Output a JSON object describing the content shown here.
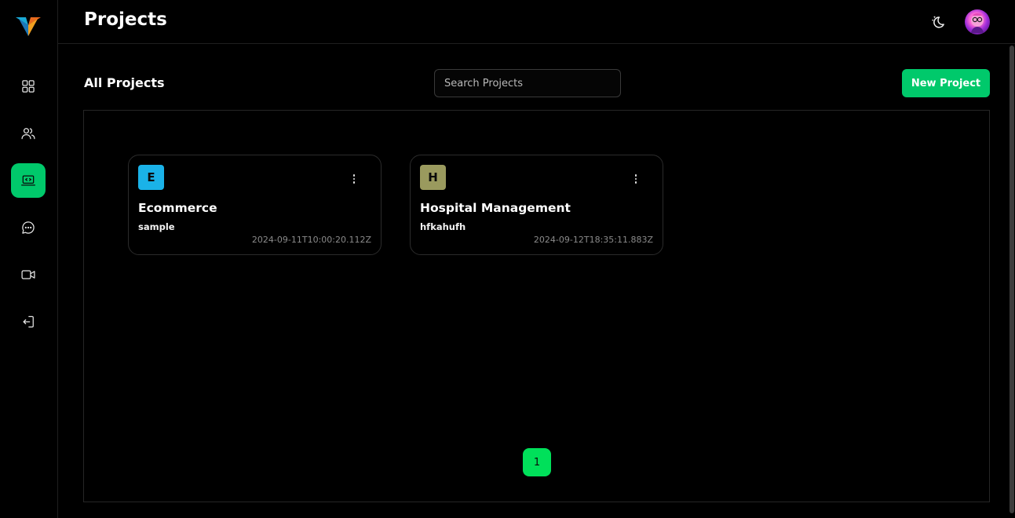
{
  "app": {
    "page_title": "Projects",
    "brand_colors": {
      "accent": "#00c96b",
      "page_accent": "#00e05a",
      "background": "#000000"
    }
  },
  "sidebar": {
    "items": [
      {
        "icon": "dashboard-grid-icon",
        "active": false
      },
      {
        "icon": "users-icon",
        "active": false
      },
      {
        "icon": "laptop-code-icon",
        "active": true
      },
      {
        "icon": "chat-bubble-icon",
        "active": false
      },
      {
        "icon": "video-camera-icon",
        "active": false
      },
      {
        "icon": "logout-icon",
        "active": false
      }
    ]
  },
  "header": {
    "theme_icon": "moon-stars-icon",
    "avatar": "user-avatar"
  },
  "toolbar": {
    "section_title": "All Projects",
    "search_placeholder": "Search Projects",
    "new_project_label": "New Project"
  },
  "projects": [
    {
      "initial": "E",
      "badge_color": "#1ab2e8",
      "name": "Ecommerce",
      "description": "sample",
      "created_at": "2024-09-11T10:00:20.112Z"
    },
    {
      "initial": "H",
      "badge_color": "#9a9a5e",
      "name": "Hospital Management",
      "description": "hfkahufh",
      "created_at": "2024-09-12T18:35:11.883Z"
    }
  ],
  "pagination": {
    "current_page": "1"
  }
}
